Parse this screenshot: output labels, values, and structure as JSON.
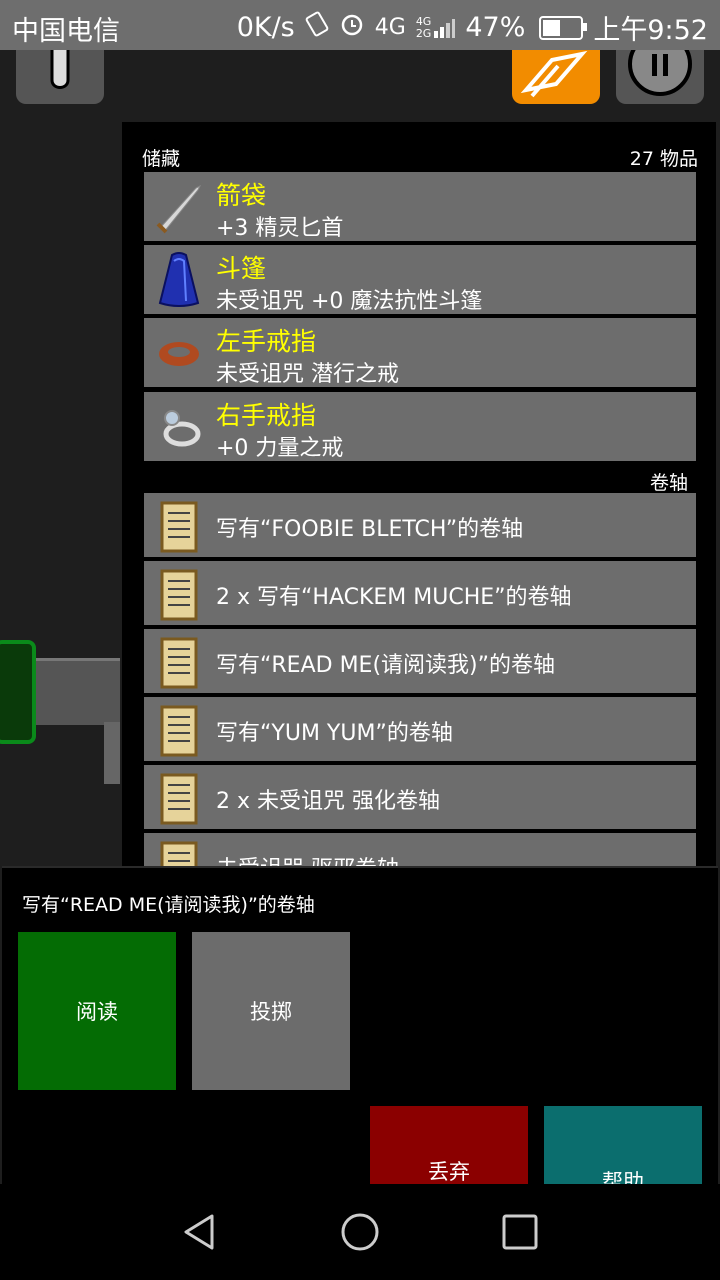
{
  "status_bar": {
    "carrier": "中国电信",
    "net_speed": "0K/s",
    "signal_1": "4G",
    "signal_2a": "4G",
    "signal_2b": "2G",
    "battery_percent": "47%",
    "battery_level": 0.47,
    "time": "上午9:52"
  },
  "inventory": {
    "title": "储藏",
    "count_label": "27 物品",
    "equipped": [
      {
        "slot": "箭袋",
        "name": "+3 精灵匕首",
        "icon": "dagger-icon"
      },
      {
        "slot": "斗篷",
        "name": "未受诅咒 +0 魔法抗性斗篷",
        "icon": "cloak-icon"
      },
      {
        "slot": "左手戒指",
        "name": "未受诅咒 潜行之戒",
        "icon": "copper-ring-icon"
      },
      {
        "slot": "右手戒指",
        "name": "+0 力量之戒",
        "icon": "silver-ring-icon"
      }
    ],
    "scroll_section": "卷轴",
    "scrolls": [
      {
        "name": "写有“FOOBIE BLETCH”的卷轴"
      },
      {
        "name": "2 x 写有“HACKEM MUCHE”的卷轴"
      },
      {
        "name": "写有“READ ME(请阅读我)”的卷轴"
      },
      {
        "name": "写有“YUM YUM”的卷轴"
      },
      {
        "name": "2 x 未受诅咒 强化卷轴"
      },
      {
        "name": "未受诅咒 驱邪卷轴"
      }
    ]
  },
  "action_sheet": {
    "selected_item": "写有“READ ME(请阅读我)”的卷轴",
    "read_label": "阅读",
    "throw_label": "投掷",
    "drop_label": "丢弃",
    "help_label": "帮助"
  },
  "colors": {
    "slot_text": "#ffff00",
    "read": "#046c04",
    "throw": "#6c6c6c",
    "drop": "#8b0000",
    "help": "#0b6e6e",
    "accent_orange": "#f28c00"
  }
}
